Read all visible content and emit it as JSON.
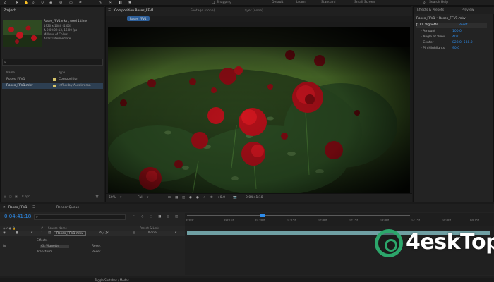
{
  "toolbar": {
    "workspaces": [
      "Default",
      "Learn",
      "Standard",
      "Small Screen"
    ],
    "active_workspace": "Standard",
    "snapping": "Snapping",
    "search_help": "Search Help"
  },
  "project": {
    "title": "Project",
    "file_name": "Roses_FFV1.mkv , used 1 time",
    "info_lines": [
      "1920 x 1080 (1.00)",
      "Δ 0:00:09:13, 16.00 fps",
      "Millions of Colors",
      "Alfas: Intermediate"
    ],
    "columns": [
      "Name",
      "Type"
    ],
    "items": [
      {
        "name": "Roses_FFV1",
        "type": "Composition",
        "color": "#d6c46a",
        "selected": false
      },
      {
        "name": "Roses_FFV1.mkv",
        "type": "Influx by Autokroma",
        "color": "#d6c46a",
        "selected": true
      }
    ],
    "footer": "8 bpc"
  },
  "composition": {
    "tabs": [
      "Composition Roses_FFV1",
      "Footage (none)",
      "Layer (none)"
    ],
    "breadcrumb": "Roses_FFV1",
    "zoom": "50%",
    "quality": "Full",
    "timecode": "0:04:41:18",
    "exposure": "+0.0"
  },
  "effects": {
    "tabs": [
      "Effects & Presets",
      "Preview"
    ],
    "header": "Roses_FFV1 • Roses_FFV1.mkv",
    "effect_name": "CL Vignette",
    "reset": "Reset",
    "properties": [
      {
        "label": "Amount",
        "value": "100.0"
      },
      {
        "label": "Angle of View",
        "value": "40.0"
      },
      {
        "label": "Center",
        "value": "828.0, 538.0"
      },
      {
        "label": "Pin Highlights",
        "value": "90.0"
      }
    ]
  },
  "timeline": {
    "comp_tab": "Roses_FFV1",
    "render_queue": "Render Queue",
    "timecode": "0:04:41:18",
    "columns": [
      "#",
      "Source Name",
      "Parent & Link"
    ],
    "layer": {
      "number": "1",
      "name": "Roses_FFV1.mkv",
      "parent": "None"
    },
    "sub": {
      "effects": "Effects",
      "effect": "CL Vignette",
      "reset": "Reset",
      "transform": "Transform",
      "transform_reset": "Reset"
    },
    "ruler": [
      "0:00f",
      "00:15f",
      "01:00f",
      "01:15f",
      "02:00f",
      "02:15f",
      "03:00f",
      "03:15f",
      "04:00f",
      "04:15f"
    ],
    "footer_mode": "Toggle Switches / Modes"
  },
  "watermark": {
    "brand": "4eskTop"
  },
  "colors": {
    "accent": "#2d8ceb",
    "watermark_green": "#2ca66b"
  }
}
